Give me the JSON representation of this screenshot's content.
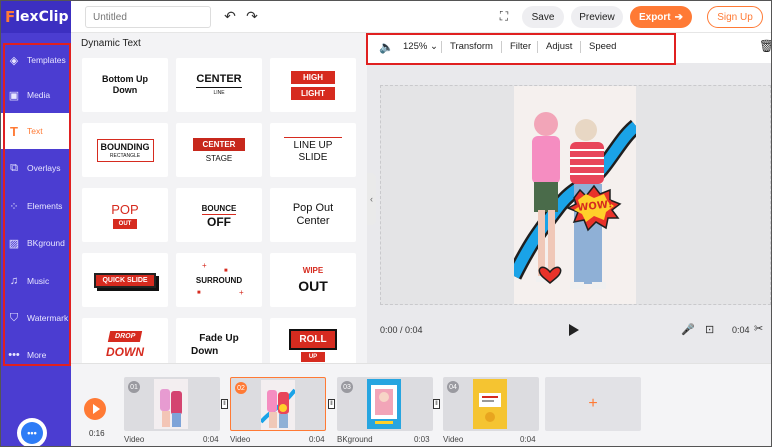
{
  "app": {
    "logo_f": "F",
    "logo_text": "lexClip",
    "title_placeholder": "Untitled"
  },
  "topbar": {
    "undo_icon": "undo-icon",
    "redo_icon": "redo-icon",
    "fullscreen_icon": "fullscreen-icon",
    "save_label": "Save",
    "preview_label": "Preview",
    "export_label": "Export",
    "signup_label": "Sign Up",
    "accent": "#ff7a35"
  },
  "sidebar": {
    "bg": "#4b3dd1",
    "items": [
      {
        "label": "Templates",
        "icon": "layers-icon"
      },
      {
        "label": "Media",
        "icon": "folder-icon"
      },
      {
        "label": "Text",
        "icon": "text-icon",
        "active": true
      },
      {
        "label": "Overlays",
        "icon": "overlay-icon"
      },
      {
        "label": "Elements",
        "icon": "elements-icon"
      },
      {
        "label": "BKground",
        "icon": "background-icon"
      },
      {
        "label": "Music",
        "icon": "music-icon"
      },
      {
        "label": "Watermark",
        "icon": "watermark-icon"
      },
      {
        "label": "More",
        "icon": "more-icon"
      }
    ]
  },
  "panel": {
    "title": "Dynamic Text",
    "tiles": {
      "bottom_up_1": "Bottom Up",
      "bottom_up_2": "Down",
      "center": "CENTER",
      "center_sub": "LINE",
      "high": "HIGH",
      "light": "LIGHT",
      "bounding": "BOUNDING",
      "bounding_sub": "RECTANGLE",
      "center2": "CENTER",
      "stage": "STAGE",
      "lineup_1": "LINE UP",
      "lineup_2": "SLIDE",
      "pop": "POP",
      "out": "OUT",
      "bounce": "BOUNCE",
      "off": "OFF",
      "popout_1": "Pop Out",
      "popout_2": "Center",
      "quick_slide": "QUICK SLIDE",
      "surround": "SURROUND",
      "wipe": "WIPE",
      "wipe_out": "OUT",
      "drop": "DROP",
      "down": "DOWN",
      "fadeup_1": "Fade Up",
      "fadeup_2": "Down",
      "roll": "ROLL",
      "up": "UP"
    }
  },
  "editor": {
    "volume_icon": "volume-icon",
    "zoom": "125%",
    "tools": [
      "Transform",
      "Filter",
      "Adjust",
      "Speed"
    ],
    "trash_icon": "trash-icon",
    "sticker_text": "WOW!",
    "time_current": "0:00 / 0:04",
    "time_total": "0:04"
  },
  "timeline": {
    "time": "0:16",
    "clips": [
      {
        "num": "01",
        "label": "Video",
        "dur": "0:04"
      },
      {
        "num": "02",
        "label": "Video",
        "dur": "0:04"
      },
      {
        "num": "03",
        "label": "BKground",
        "dur": "0:03"
      },
      {
        "num": "04",
        "label": "Video",
        "dur": "0:04"
      }
    ],
    "add_icon": "plus-icon"
  },
  "chat": {
    "icon": "chat-icon",
    "text": "•••"
  }
}
